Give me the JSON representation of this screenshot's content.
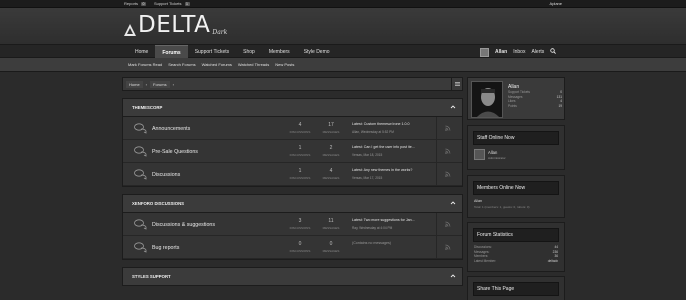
{
  "topbar": {
    "reports_label": "Reports",
    "reports_count": "0",
    "tickets_label": "Support Tickets",
    "tickets_count": "1",
    "user": "Aplane"
  },
  "logo": {
    "word": "DELTA",
    "sub": "Dark"
  },
  "nav": {
    "tabs": [
      {
        "label": "Home"
      },
      {
        "label": "Forums"
      },
      {
        "label": "Support Tickets"
      },
      {
        "label": "Shop"
      },
      {
        "label": "Members"
      },
      {
        "label": "Style Demo"
      }
    ],
    "user": "Allan",
    "inbox": "Inbox",
    "alerts": "Alerts"
  },
  "subnav": [
    "Mark Forums Read",
    "Search Forums",
    "Watched Forums",
    "Watched Threads",
    "New Posts"
  ],
  "breadcrumb": [
    "Home",
    "Forums"
  ],
  "categories": [
    {
      "title": "THEMESCORP",
      "forums": [
        {
          "name": "Announcements",
          "discussions": "4",
          "messages": "17",
          "disc_label": "DISCUSSIONS",
          "msg_label": "MESSAGES",
          "latest": "Latest: Custom themesw lrone 1.0.0",
          "meta": "Allan, Wednesday at 5:52 PM"
        },
        {
          "name": "Pre-Sale Questions",
          "discussions": "1",
          "messages": "2",
          "disc_label": "DISCUSSIONS",
          "msg_label": "MESSAGES",
          "latest": "Latest: Can I get the user info post ite...",
          "meta": "Versas, Mar 18, 2015"
        },
        {
          "name": "Discussions",
          "discussions": "1",
          "messages": "4",
          "disc_label": "DISCUSSIONS",
          "msg_label": "MESSAGES",
          "latest": "Latest: Any new themes in the works?",
          "meta": "Versas, Mar 17, 2015"
        }
      ]
    },
    {
      "title": "XENFORO DISCUSSIONS",
      "forums": [
        {
          "name": "Discussions & suggestions",
          "discussions": "3",
          "messages": "11",
          "disc_label": "DISCUSSIONS",
          "msg_label": "MESSAGES",
          "latest": "Latest: Two more suggestions for Jan...",
          "meta": "Ray, Wednesday at 4:04 PM"
        },
        {
          "name": "Bug reports",
          "discussions": "0",
          "messages": "0",
          "disc_label": "DISCUSSIONS",
          "msg_label": "MESSAGES",
          "latest": "(Contains no messages)",
          "meta": ""
        }
      ]
    },
    {
      "title": "STYLES SUPPORT",
      "forums": []
    }
  ],
  "profile": {
    "name": "Allan",
    "stats": [
      {
        "label": "Support Tickets",
        "value": "0"
      },
      {
        "label": "Messages",
        "value": "131"
      },
      {
        "label": "Likes",
        "value": "4"
      },
      {
        "label": "Points",
        "value": "19"
      }
    ]
  },
  "staff_online": {
    "title": "Staff Online Now",
    "name": "Allan",
    "role": "Administrator"
  },
  "members_online": {
    "title": "Members Online Now",
    "names": "Allan",
    "summary": "Total: 1 (members: 1, guests: 0, robots: 0)"
  },
  "forum_stats": {
    "title": "Forum Statistics",
    "rows": [
      {
        "label": "Discussions:",
        "value": "44"
      },
      {
        "label": "Messages:",
        "value": "236"
      },
      {
        "label": "Members:",
        "value": "36"
      },
      {
        "label": "Latest Member:",
        "value": "deltadx"
      }
    ]
  },
  "share": {
    "title": "Share This Page"
  }
}
